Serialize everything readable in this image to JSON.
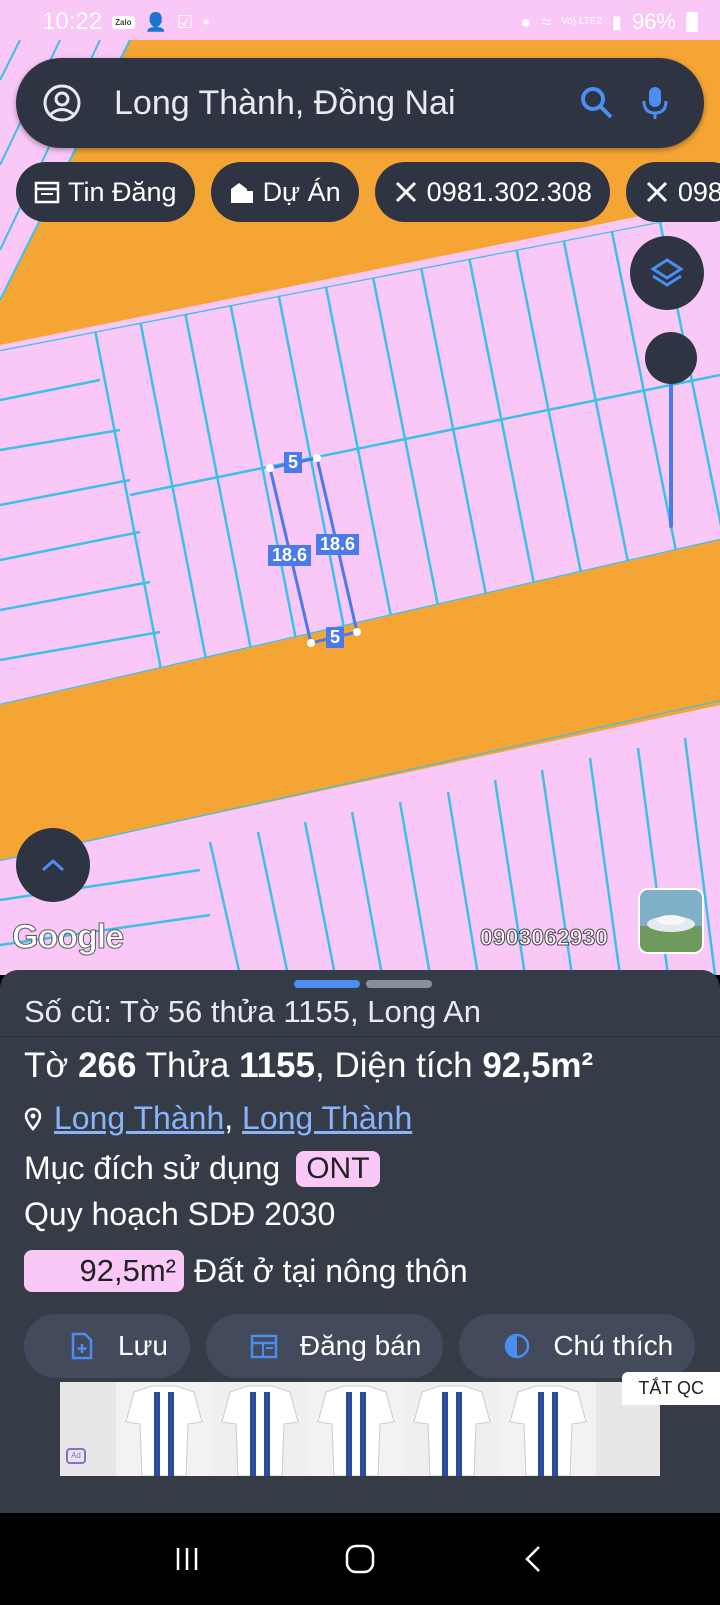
{
  "status_bar": {
    "time": "10:22",
    "zalo_badge": "Zalo",
    "battery": "96%",
    "network": "Vo) LTE2"
  },
  "search": {
    "query": "Long Thành, Đồng Nai"
  },
  "chips": [
    {
      "label": "Tin Đăng",
      "icon": "calendar-icon"
    },
    {
      "label": "Dự Án",
      "icon": "buildings-icon"
    },
    {
      "label": "0981.302.308",
      "icon": "tools-icon"
    },
    {
      "label": "098",
      "icon": "tools-icon"
    }
  ],
  "map": {
    "dimension_top": "5",
    "dimension_bottom": "5",
    "dimension_left": "18.6",
    "dimension_right": "18.6",
    "google_logo": "Google",
    "phone_watermark": "0903062930",
    "colors": {
      "parcel_fill": "#f9c8f7",
      "road_fill": "#f5a533",
      "lot_lines": "#3cc0e8",
      "selected": "#4a7bea"
    }
  },
  "sheet": {
    "old_number": "Số cũ: Tờ 56 thửa 1155, Long An",
    "line_to": "Tờ",
    "to_value": "266",
    "line_thua": "Thửa",
    "thua_value": "1155",
    "line_area_label": ", Diện tích",
    "area_value": "92,5m²",
    "location_1": "Long Thành",
    "location_sep": ",",
    "location_2": "Long Thành",
    "purpose_label": "Mục đích sử dụng",
    "purpose_code": "ONT",
    "plan_label": "Quy hoạch SDĐ 2030",
    "plan_area": "92,5m²",
    "plan_desc": "Đất ở tại nông thôn",
    "actions": [
      {
        "label": "Lưu",
        "icon": "save-file-icon"
      },
      {
        "label": "Đăng bán",
        "icon": "listing-icon"
      },
      {
        "label": "Chú thích",
        "icon": "legend-icon"
      }
    ],
    "ad_close": "TẮT QC",
    "ad_mark": "Ad"
  }
}
